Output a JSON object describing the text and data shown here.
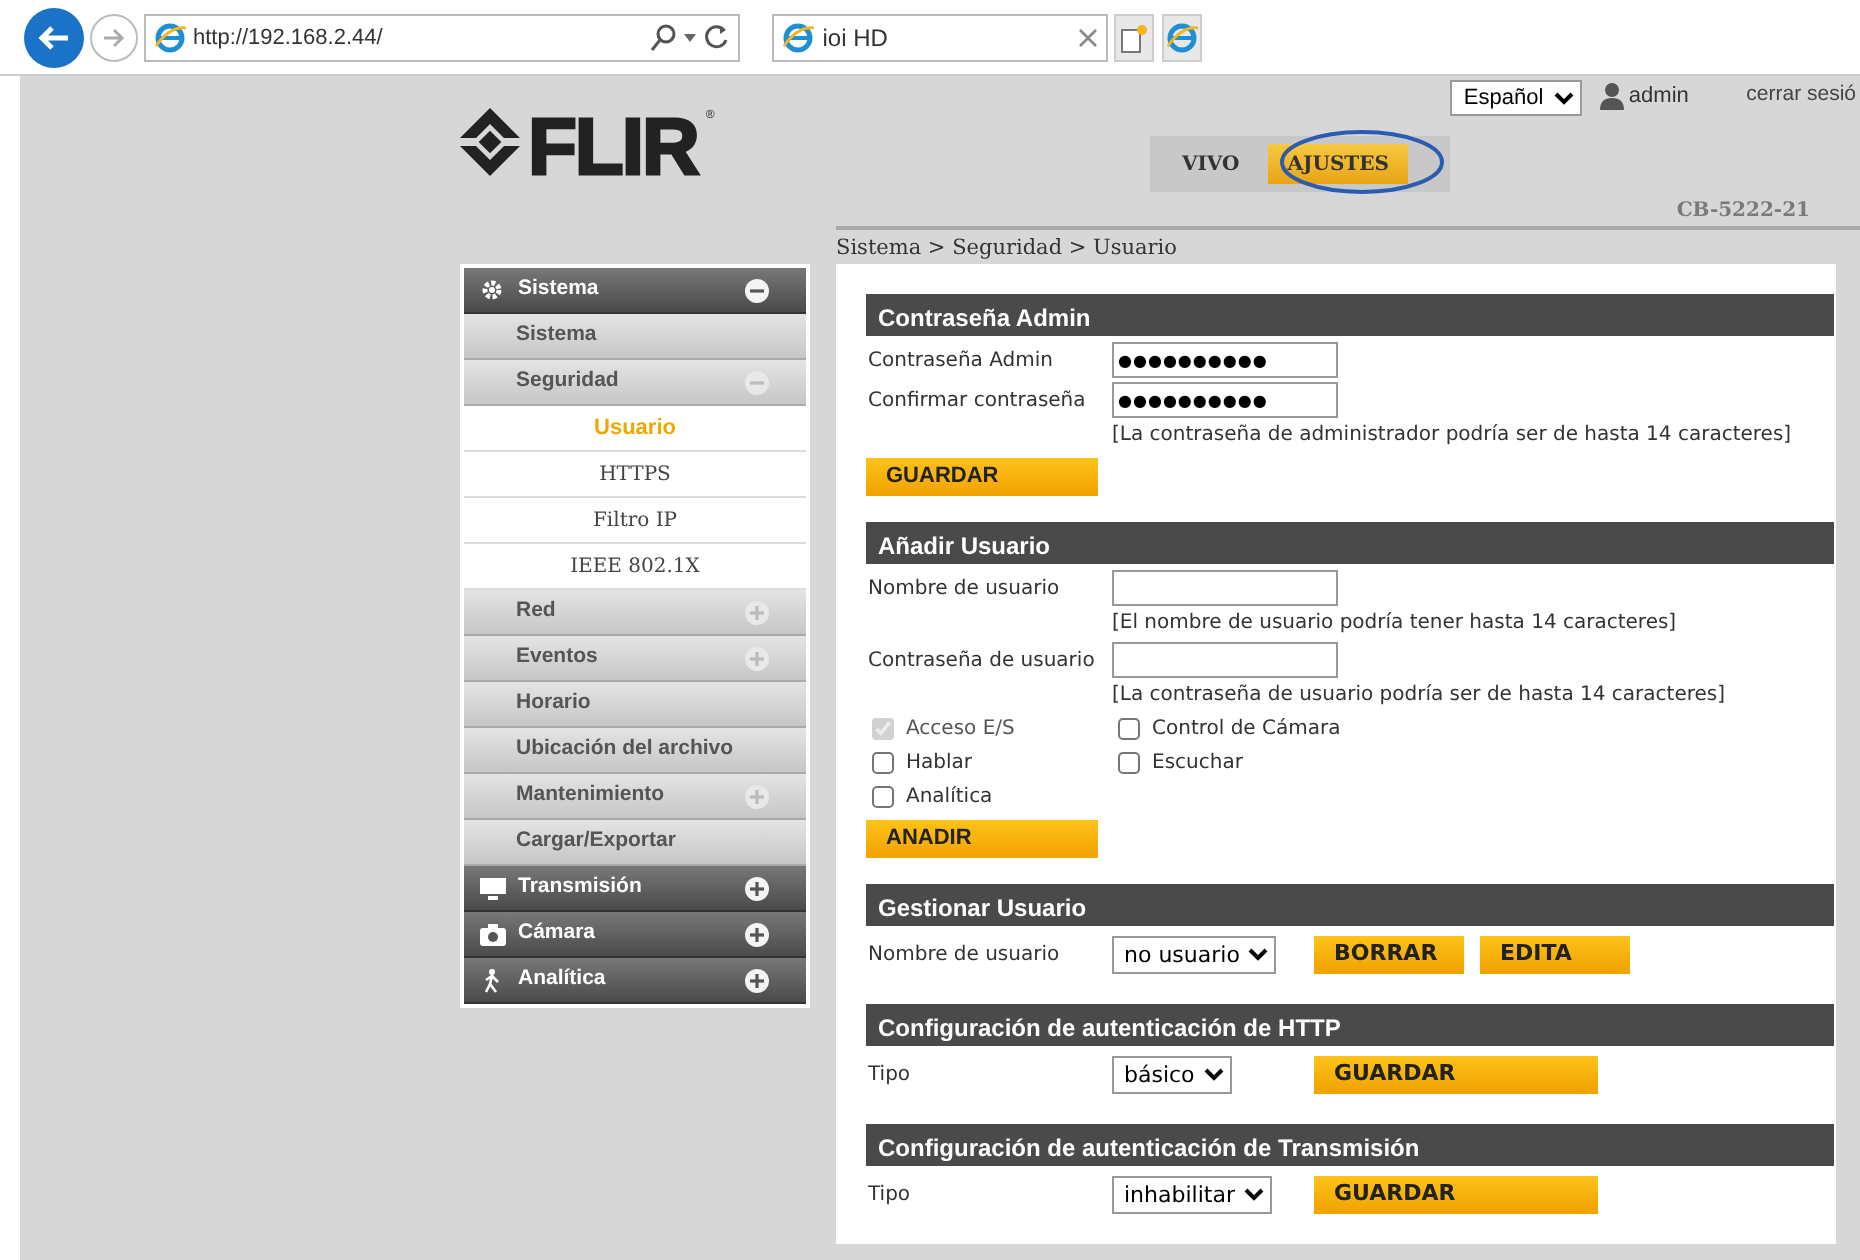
{
  "browser": {
    "url": "http://192.168.2.44/",
    "tab_title": "ioi HD"
  },
  "header": {
    "logo": "FLIR",
    "logo_mark": "®",
    "language": "Español",
    "user": "admin",
    "logout": "cerrar sesió",
    "device": "CB-5222-21",
    "tabs": [
      {
        "label": "VIVO",
        "selected": false
      },
      {
        "label": "AJUSTES",
        "selected": true
      }
    ]
  },
  "breadcrumb": "Sistema > Seguridad > Usuario",
  "sidebar": {
    "items": [
      {
        "label": "Sistema",
        "kind": "group",
        "expanded": true,
        "children": [
          {
            "label": "Sistema",
            "kind": "sub"
          },
          {
            "label": "Seguridad",
            "kind": "sub",
            "expanded": true,
            "children": [
              {
                "label": "Usuario",
                "kind": "leaf",
                "selected": true
              },
              {
                "label": "HTTPS",
                "kind": "leaf",
                "selected": false
              },
              {
                "label": "Filtro IP",
                "kind": "leaf",
                "selected": false
              },
              {
                "label": "IEEE 802.1X",
                "kind": "leaf",
                "selected": false
              }
            ]
          },
          {
            "label": "Red",
            "kind": "sub",
            "expanded": false
          },
          {
            "label": "Eventos",
            "kind": "sub",
            "expanded": false
          },
          {
            "label": "Horario",
            "kind": "sub"
          },
          {
            "label": "Ubicación del archivo",
            "kind": "sub"
          },
          {
            "label": "Mantenimiento",
            "kind": "sub",
            "expanded": false
          },
          {
            "label": "Cargar/Exportar",
            "kind": "sub"
          }
        ]
      },
      {
        "label": "Transmisión",
        "kind": "group",
        "expanded": false
      },
      {
        "label": "Cámara",
        "kind": "group",
        "expanded": false
      },
      {
        "label": "Analítica",
        "kind": "group",
        "expanded": false
      }
    ]
  },
  "sections": [
    {
      "title": "Contraseña Admin",
      "rows": [
        {
          "kind": "field",
          "label": "Contraseña Admin",
          "value": "●●●●●●●●●●"
        },
        {
          "kind": "field",
          "label": "Confirmar contraseña",
          "value": "●●●●●●●●●●"
        },
        {
          "kind": "hint",
          "text": "[La contraseña de administrador podría ser de hasta 14 caracteres]"
        },
        {
          "kind": "buttons",
          "buttons": [
            {
              "label": "GUARDAR",
              "wide": false
            }
          ]
        }
      ]
    },
    {
      "title": "Añadir Usuario",
      "rows": [
        {
          "kind": "field",
          "label": "Nombre de usuario"
        },
        {
          "kind": "hint",
          "text": "[El nombre de usuario podría tener hasta 14 caracteres]"
        },
        {
          "kind": "field",
          "label": "Contraseña de usuario"
        },
        {
          "kind": "hint",
          "text": "[La contraseña de usuario podría ser de hasta 14 caracteres]"
        },
        {
          "kind": "checks",
          "items": [
            {
              "label": "Acceso E/S",
              "checked": true,
              "disabled": true
            },
            {
              "label": "Control de Cámara",
              "checked": false,
              "disabled": false
            },
            {
              "label": "Hablar",
              "checked": false,
              "disabled": false
            },
            {
              "label": "Escuchar",
              "checked": false,
              "disabled": false
            },
            {
              "label": "Analítica",
              "checked": false,
              "disabled": false
            }
          ]
        },
        {
          "kind": "buttons",
          "buttons": [
            {
              "label": "ANADIR",
              "wide": false
            }
          ]
        }
      ]
    },
    {
      "title": "Gestionar Usuario",
      "rows": [
        {
          "kind": "select",
          "label": "Nombre de usuario",
          "value": "no usuario",
          "buttons": [
            {
              "label": "BORRAR",
              "wide": false
            },
            {
              "label": "EDITA",
              "wide": false
            }
          ]
        }
      ]
    },
    {
      "title": "Configuración de autenticación de HTTP",
      "rows": [
        {
          "kind": "select",
          "label": "Tipo",
          "value": "básico",
          "buttons": [
            {
              "label": "GUARDAR",
              "wide": true
            }
          ]
        }
      ]
    },
    {
      "title": "Configuración de autenticación de Transmisión",
      "rows": [
        {
          "kind": "select",
          "label": "Tipo",
          "value": "inhabilitar",
          "buttons": [
            {
              "label": "GUARDAR",
              "wide": true
            }
          ]
        }
      ]
    }
  ]
}
